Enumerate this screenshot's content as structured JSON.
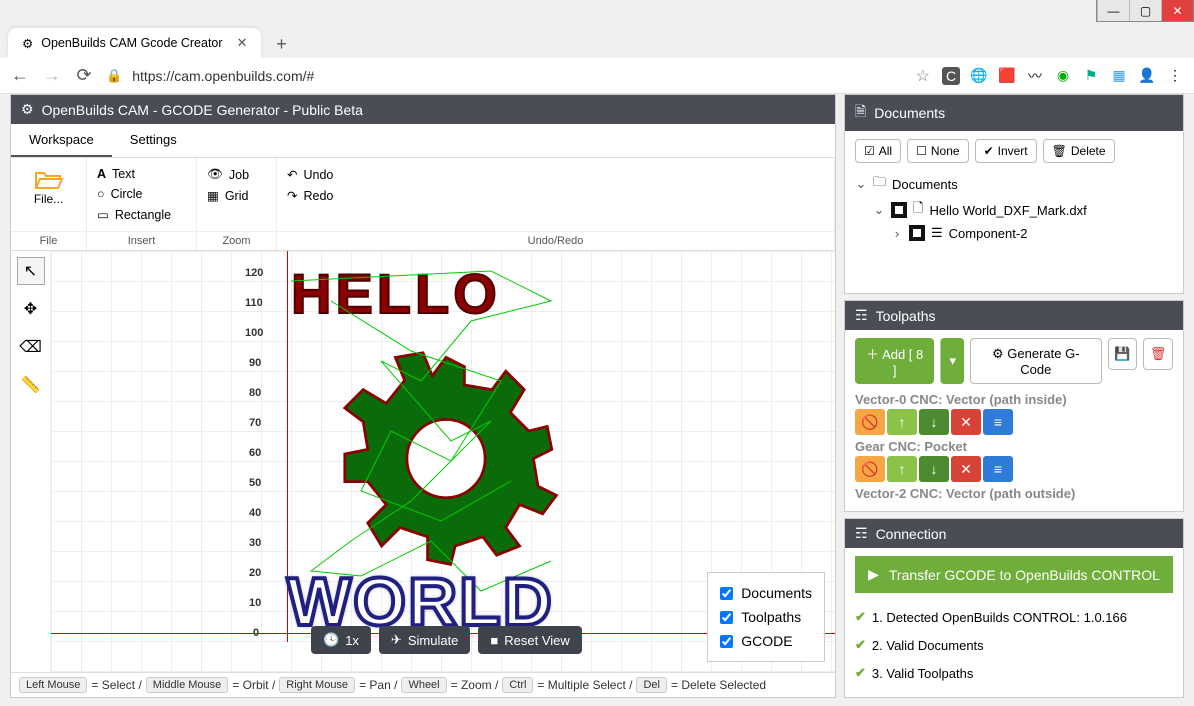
{
  "window": {
    "tab_title": "OpenBuilds CAM Gcode Creator",
    "url": "https://cam.openbuilds.com/#"
  },
  "app_title": "OpenBuilds CAM - GCODE Generator - Public Beta",
  "tabs": {
    "workspace": "Workspace",
    "settings": "Settings"
  },
  "ribbon": {
    "file": {
      "open": "File...",
      "label": "File"
    },
    "insert": {
      "text": "Text",
      "circle": "Circle",
      "rect": "Rectangle",
      "label": "Insert"
    },
    "zoom": {
      "job": "Job",
      "grid": "Grid",
      "label": "Zoom"
    },
    "undo": {
      "undo": "Undo",
      "redo": "Redo",
      "label": "Undo/Redo"
    }
  },
  "yticks": [
    "120",
    "110",
    "100",
    "90",
    "80",
    "70",
    "60",
    "50",
    "40",
    "30",
    "20",
    "10",
    "0"
  ],
  "layers": {
    "documents": "Documents",
    "toolpaths": "Toolpaths",
    "gcode": "GCODE"
  },
  "simbar": {
    "speed": "1x",
    "simulate": "Simulate",
    "reset": "Reset View"
  },
  "hint": {
    "lm": "Left Mouse",
    "lm_t": " = Select / ",
    "mm": "Middle Mouse",
    "mm_t": " = Orbit / ",
    "rm": "Right Mouse",
    "rm_t": " = Pan / ",
    "wh": "Wheel",
    "wh_t": " = Zoom / ",
    "ct": "Ctrl",
    "ct_t": " = Multiple Select / ",
    "dl": "Del",
    "dl_t": " = Delete Selected"
  },
  "documents": {
    "title": "Documents",
    "btns": {
      "all": "All",
      "none": "None",
      "invert": "Invert",
      "delete": "Delete"
    },
    "tree": {
      "root": "Documents",
      "file": "Hello World_DXF_Mark.dxf",
      "comp": "Component-2"
    }
  },
  "toolpaths": {
    "title": "Toolpaths",
    "add": "Add [ 8 ]",
    "gen": "Generate G-Code",
    "items": [
      {
        "label": "Vector-0 CNC: Vector (path inside)"
      },
      {
        "label": "Gear CNC: Pocket"
      },
      {
        "label": "Vector-2 CNC: Vector (path outside)"
      }
    ]
  },
  "connection": {
    "title": "Connection",
    "btn": "Transfer GCODE to OpenBuilds CONTROL",
    "items": [
      "1. Detected OpenBuilds CONTROL: 1.0.166",
      "2. Valid Documents",
      "3. Valid Toolpaths"
    ]
  }
}
